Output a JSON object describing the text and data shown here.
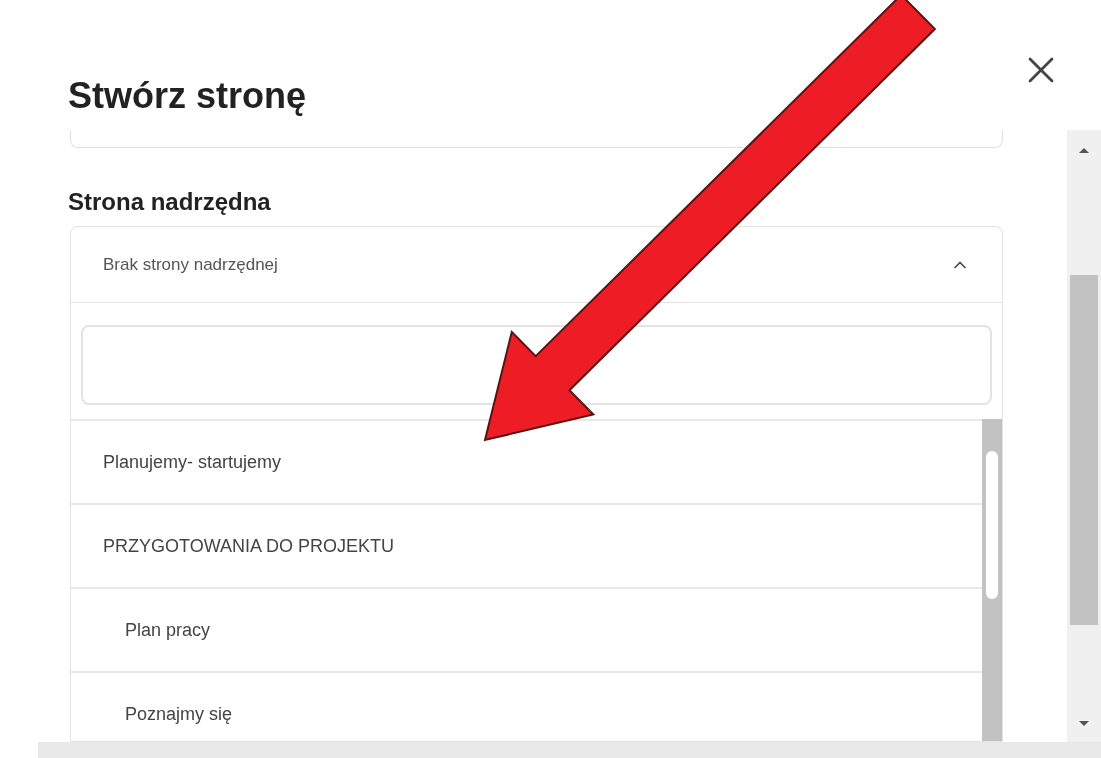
{
  "dialog": {
    "title": "Stwórz stronę"
  },
  "parent_page": {
    "label": "Strona nadrzędna",
    "value": "Brak strony nadrzędnej",
    "expanded": true
  },
  "options": [
    {
      "label": "Planujemy- startujemy"
    },
    {
      "label": "PRZYGOTOWANIA DO PROJEKTU",
      "children": [
        {
          "label": "Plan pracy"
        },
        {
          "label": "Poznajmy się"
        }
      ]
    }
  ]
}
